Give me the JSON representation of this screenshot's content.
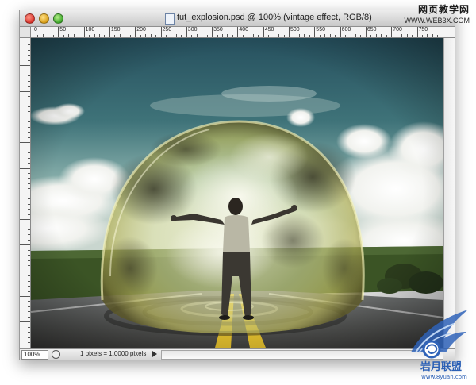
{
  "window": {
    "title": "tut_explosion.psd @ 100% (vintage effect, RGB/8)"
  },
  "ruler": {
    "labels": [
      "0",
      "50",
      "100",
      "150",
      "200",
      "250",
      "300",
      "350",
      "400",
      "450",
      "500",
      "550",
      "600",
      "650",
      "700",
      "750"
    ]
  },
  "statusbar": {
    "zoom": "100%",
    "info": "1 pixels = 1.0000 pixels"
  },
  "watermark_top": {
    "title": "网页教学网",
    "url": "WWW.WEB3X.COM"
  },
  "watermark_bottom": {
    "title": "岩月联盟",
    "url": "www.8yuan.com"
  },
  "colors": {
    "sky_top": "#2f5d68",
    "sky_mid": "#6fa1a3",
    "bubble": "#e7e8a0",
    "road_line": "#e8c420",
    "grass": "#3c5624"
  }
}
